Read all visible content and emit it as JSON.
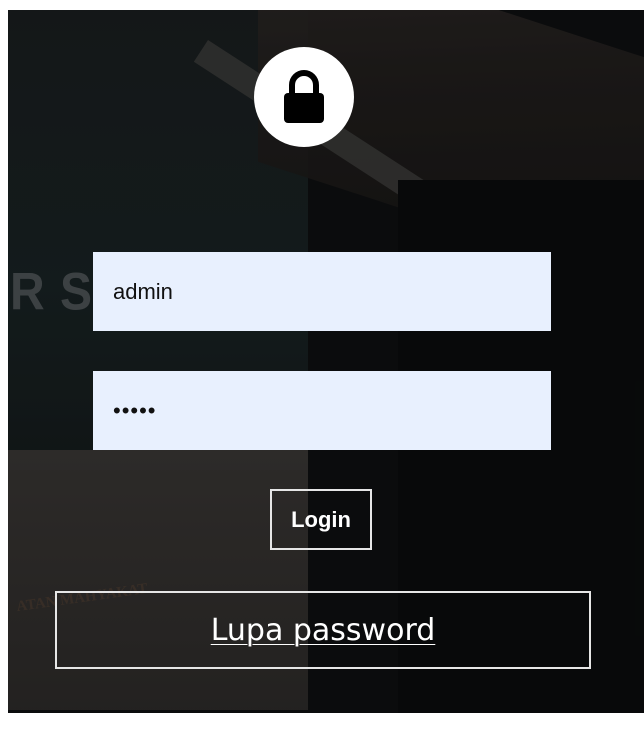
{
  "login_form": {
    "username_value": "admin",
    "password_value": "•••••",
    "login_label": "Login",
    "forgot_password_label": "Lupa password"
  },
  "background": {
    "sign_fragment": "R SE",
    "banner_fragment": "ATAN MAHYAKAT"
  },
  "icons": {
    "lock": "lock-icon"
  },
  "colors": {
    "field_background": "#e8f0fe",
    "border": "#e6e6e6",
    "text_light": "#ffffff"
  }
}
